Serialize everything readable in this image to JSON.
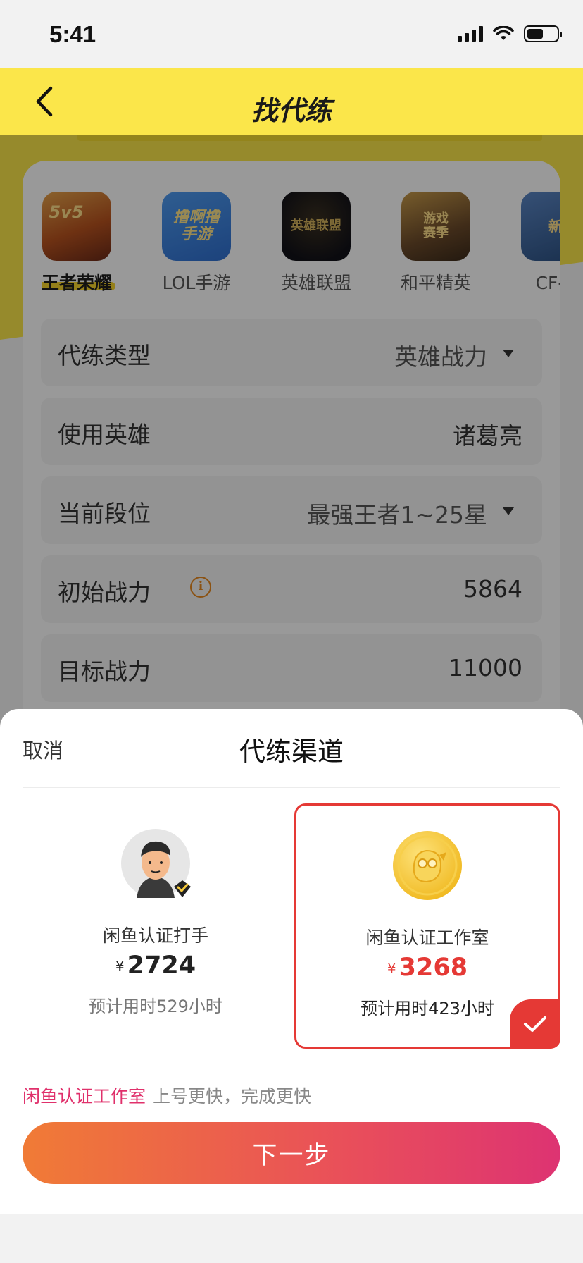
{
  "status_bar": {
    "time": "5:41"
  },
  "nav": {
    "title": "找代练",
    "back_icon": "chevron-left-icon"
  },
  "games": [
    {
      "label": "王者荣耀",
      "icon_text": "5v5",
      "color": "#b8531f",
      "active": true
    },
    {
      "label": "LOL手游",
      "icon_text": "撸啊撸\n手游",
      "color": "#2f6fcf",
      "active": false
    },
    {
      "label": "英雄联盟",
      "icon_text": "英雄联盟",
      "color": "#1b1b22",
      "active": false
    },
    {
      "label": "和平精英",
      "icon_text": "游戏\n赛季",
      "color": "#6b4a2a",
      "active": false
    },
    {
      "label": "CF手",
      "icon_text": "新",
      "color": "#2a4f80",
      "active": false
    }
  ],
  "form": {
    "type": {
      "label": "代练类型",
      "value": "英雄战力"
    },
    "hero": {
      "label": "使用英雄",
      "value": "诸葛亮"
    },
    "rank": {
      "label": "当前段位",
      "value": "最强王者1~25星"
    },
    "init_power": {
      "label": "初始战力",
      "value": "5864"
    },
    "target_power": {
      "label": "目标战力",
      "value": "11000"
    }
  },
  "sheet": {
    "cancel": "取消",
    "title": "代练渠道",
    "options": [
      {
        "name": "闲鱼认证打手",
        "currency": "¥",
        "price": "2724",
        "hours": "预计用时529小时",
        "selected": false
      },
      {
        "name": "闲鱼认证工作室",
        "currency": "¥",
        "price": "3268",
        "hours": "预计用时423小时",
        "selected": true
      }
    ],
    "promo_highlight": "闲鱼认证工作室",
    "promo_text": "上号更快，完成更快",
    "next_button": "下一步"
  },
  "colors": {
    "brand_yellow": "#fbe64a",
    "accent_red": "#e53935",
    "promo_pink": "#e0306b"
  }
}
